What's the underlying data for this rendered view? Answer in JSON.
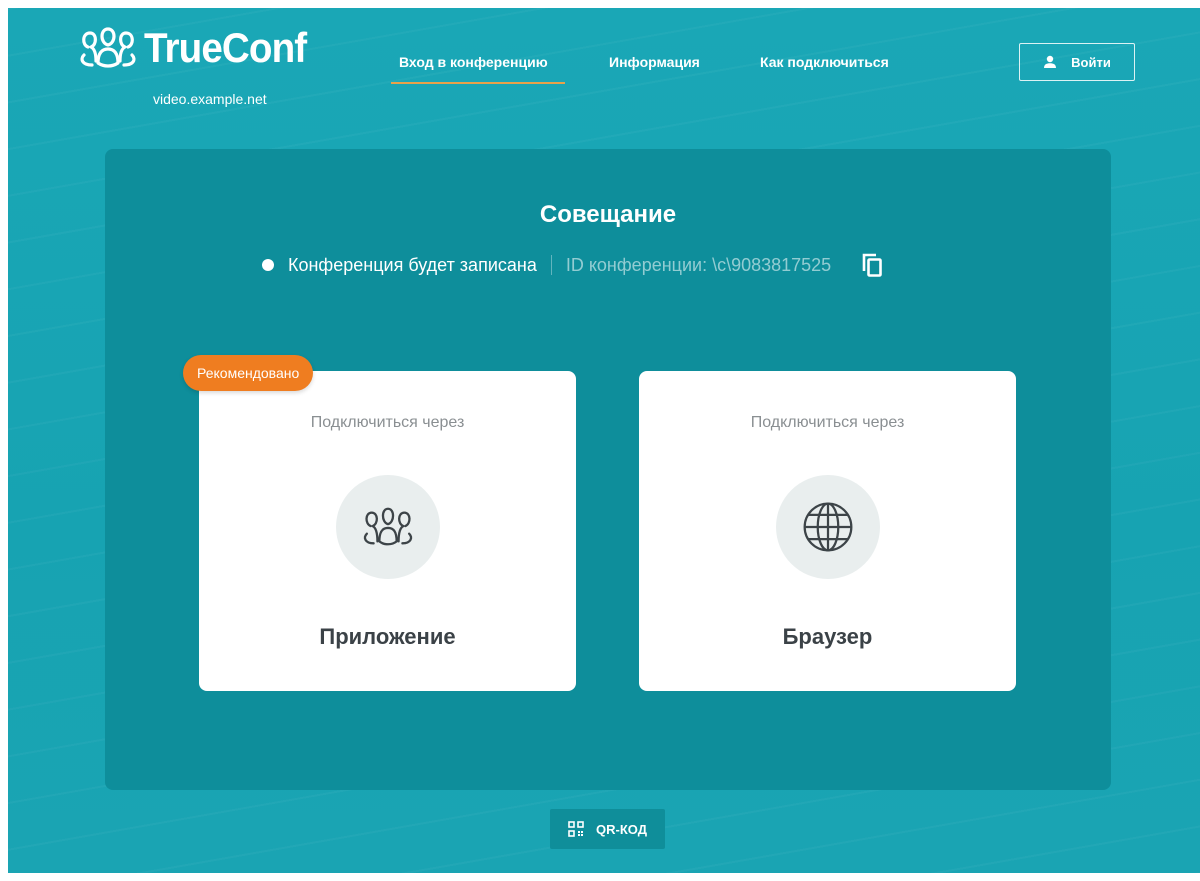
{
  "header": {
    "logo_text": "TrueConf",
    "domain": "video.example.net",
    "nav": [
      {
        "label": "Вход в конференцию",
        "active": true
      },
      {
        "label": "Информация",
        "active": false
      },
      {
        "label": "Как подключиться",
        "active": false
      }
    ],
    "login_label": "Войти"
  },
  "conference": {
    "title": "Совещание",
    "recording_notice": "Конференция будет записана",
    "id_text": "ID конференции: \\c\\9083817525"
  },
  "options": [
    {
      "via": "Подключиться через",
      "name": "Приложение",
      "badge": "Рекомендовано",
      "icon": "people-icon"
    },
    {
      "via": "Подключиться через",
      "name": "Браузер",
      "icon": "globe-icon"
    }
  ],
  "qr_label": "QR-КОД",
  "colors": {
    "background": "#1aa7b6",
    "panel": "#0e8e9b",
    "accent": "#ef7d20",
    "underline": "#e8a24a"
  }
}
